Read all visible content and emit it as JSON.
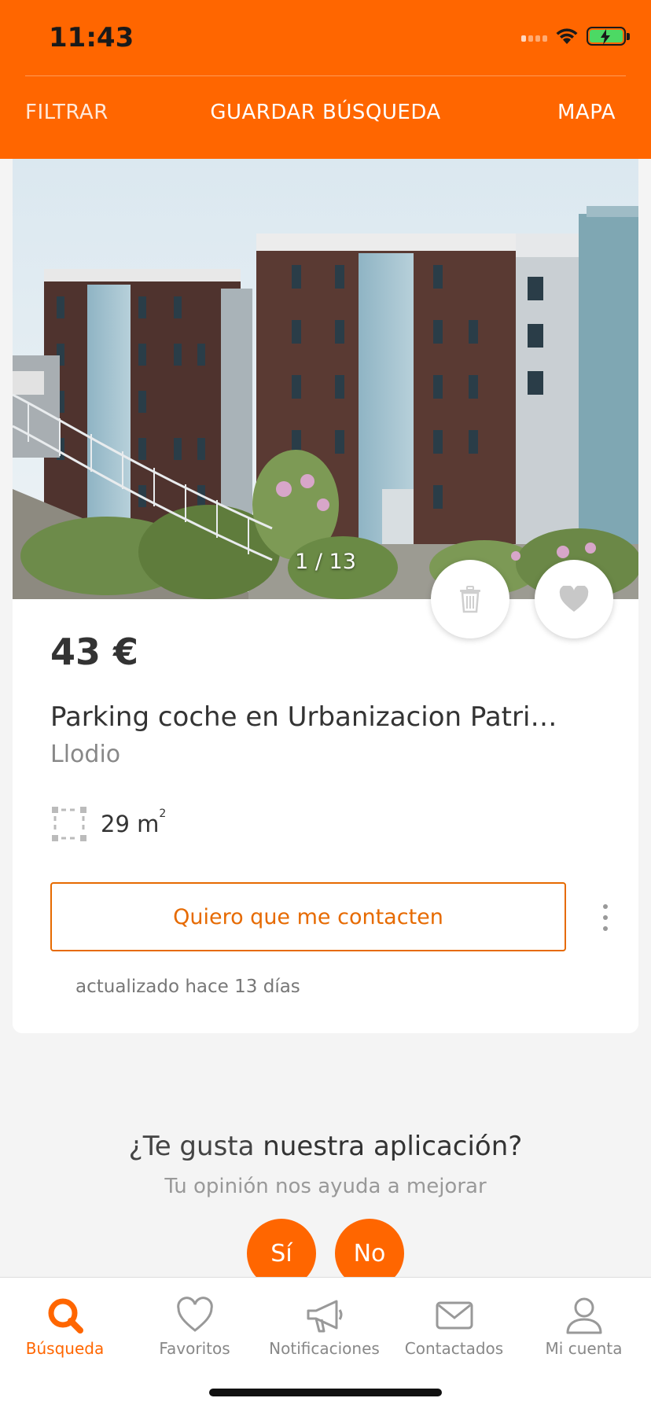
{
  "status_bar": {
    "time": "11:43"
  },
  "header": {
    "filter_label": "FILTRAR",
    "save_search_label": "GUARDAR BÚSQUEDA",
    "map_label": "MAPA",
    "accent_color": "#ff6600"
  },
  "listing": {
    "photo_counter": "1 / 13",
    "price": "43 €",
    "title": "Parking coche en Urbanizacion Patrici…",
    "location": "Llodio",
    "area_value": "29 m",
    "area_unit_sup": "2",
    "contact_label": "Quiero que me contacten",
    "updated": "actualizado hace 13 días"
  },
  "feedback": {
    "question_prefix": "¿Te gusta ",
    "question_bold": "nuestra aplicación?",
    "subtitle": "Tu opinión nos ayuda a mejorar",
    "yes_label": "Sí",
    "no_label": "No"
  },
  "tabbar": {
    "items": [
      {
        "label": "Búsqueda",
        "icon": "search-icon",
        "active": true
      },
      {
        "label": "Favoritos",
        "icon": "heart-icon",
        "active": false
      },
      {
        "label": "Notificaciones",
        "icon": "megaphone-icon",
        "active": false
      },
      {
        "label": "Contactados",
        "icon": "envelope-icon",
        "active": false
      },
      {
        "label": "Mi cuenta",
        "icon": "user-icon",
        "active": false
      }
    ]
  }
}
